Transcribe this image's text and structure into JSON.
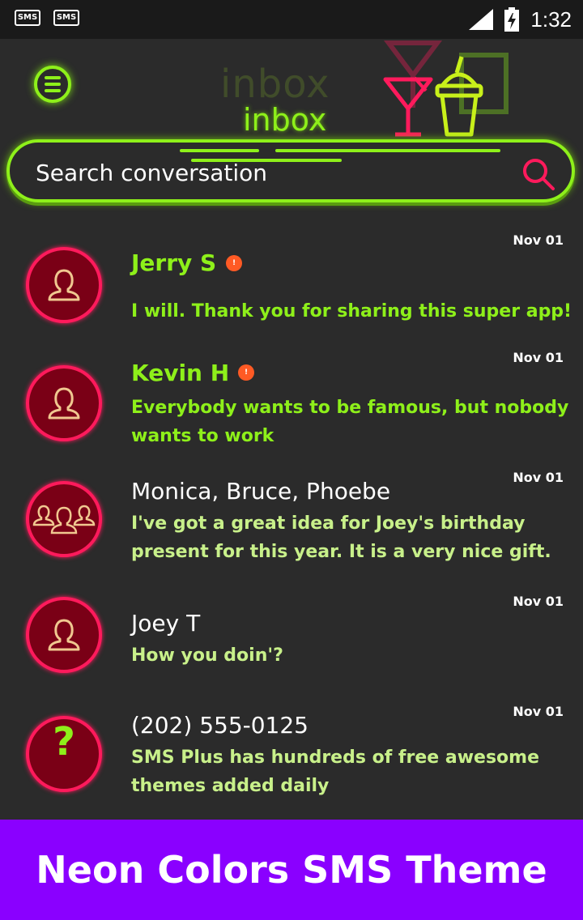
{
  "status_bar": {
    "notifications": [
      "SMS",
      "SMS"
    ],
    "time": "1:32"
  },
  "header": {
    "title": "inbox",
    "title_ghost": "inbox",
    "search_placeholder": "Search conversation"
  },
  "conversations": [
    {
      "name": "Jerry S",
      "date": "Nov 01",
      "message": "I will. Thank you for sharing this super app!",
      "unread": true,
      "avatar": "person-icon"
    },
    {
      "name": "Kevin H",
      "date": "Nov 01",
      "message": "Everybody wants to be famous, but nobody wants to work",
      "unread": true,
      "avatar": "person-icon"
    },
    {
      "name": "Monica, Bruce, Phoebe",
      "date": "Nov 01",
      "message": "I've got a great idea for Joey's birthday present for this year. It is a very nice gift.",
      "unread": false,
      "avatar": "group-icon"
    },
    {
      "name": "Joey T",
      "date": "Nov 01",
      "message": "How you doin'?",
      "unread": false,
      "avatar": "person-icon"
    },
    {
      "name": "(202) 555-0125",
      "date": "Nov 01",
      "message": "SMS Plus has hundreds of free awesome themes added daily",
      "unread": false,
      "avatar": "unknown-contact-icon",
      "avatar_glyph": "?"
    }
  ],
  "unread_badge": "!",
  "banner": {
    "text": "Neon Colors SMS Theme"
  },
  "colors": {
    "background": "#2b2b2b",
    "neon_green": "#8ef01a",
    "neon_pink": "#ff1a5c",
    "banner": "#8a00ff"
  }
}
